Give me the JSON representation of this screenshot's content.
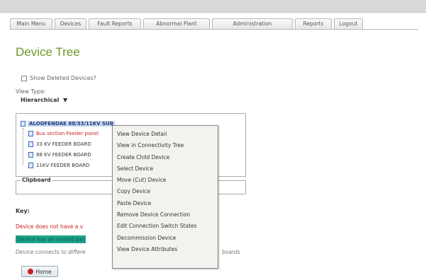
{
  "nav": {
    "tabs": [
      "Main Menu",
      "Devices",
      "Fault Reports",
      "Abnormal Plant",
      "Administration",
      "Reports",
      "Logout"
    ]
  },
  "page": {
    "title": "Device Tree",
    "show_deleted_label": "Show Deleted Devices?",
    "view_type_label": "View Type:",
    "view_type_value": "Hierarchical",
    "view_type_caret": "▼"
  },
  "tree": {
    "root_label": "ALOOFENDAE 88/33/11KV SUB",
    "children": [
      {
        "label": "Bus section Feeder panel",
        "color": "#cc1e1e"
      },
      {
        "label": "33 KV FEEDER BOARD",
        "color": "#333333"
      },
      {
        "label": "88 KV FEEDER BOARD",
        "color": "#333333"
      },
      {
        "label": "11KV FEEDER BOARD",
        "color": "#333333"
      }
    ]
  },
  "clipboard": {
    "label": "Clipboard"
  },
  "key": {
    "label": "Key:",
    "red_text": "Device does not have a v",
    "teal_text": "Device has an invalid par",
    "connect_text": "Device connects to differe",
    "connect_suffix": "boards"
  },
  "home_button": {
    "label": "Home"
  },
  "context_menu": {
    "items": [
      "View Device Detail",
      "View in Connectivity Tree",
      "Create Child Device",
      "Select Device",
      "Move (Cut) Device",
      "Copy Device",
      "Paste Device",
      "Remove Device Connection",
      "Edit Connection Switch States",
      "Decommission Device",
      "View Device Attributes"
    ]
  },
  "colors": {
    "title_green": "#6d9a2a",
    "alert_red": "#cc1e1e",
    "teal_key": "#1ba48a"
  }
}
